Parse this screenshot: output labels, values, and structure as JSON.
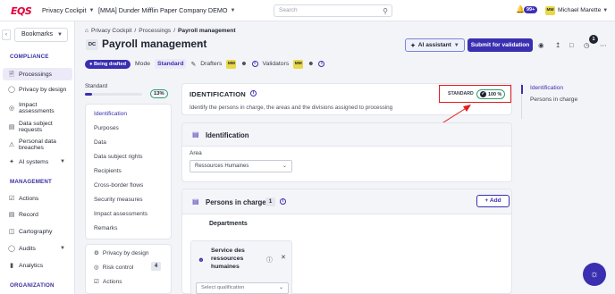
{
  "topbar": {
    "logo": "EQS",
    "product": "Privacy Cockpit",
    "company": "[MMA] Dunder Mifflin Paper Company DEMO",
    "search_placeholder": "Search",
    "notifications_badge": "99+",
    "user_initials": "MM",
    "user_name": "Michael Marette"
  },
  "sidebar": {
    "bookmarks_label": "Bookmarks",
    "sections": [
      {
        "title": "COMPLIANCE"
      },
      {
        "title": "MANAGEMENT"
      },
      {
        "title": "ORGANIZATION"
      }
    ],
    "compliance_items": [
      {
        "label": "Processings",
        "icon": "document-icon",
        "active": true
      },
      {
        "label": "Privacy by design",
        "icon": "shield-icon"
      },
      {
        "label": "Impact assessments",
        "icon": "target-icon"
      },
      {
        "label": "Data subject requests",
        "icon": "inbox-icon"
      },
      {
        "label": "Personal data breaches",
        "icon": "alert-shield-icon"
      },
      {
        "label": "AI systems",
        "icon": "sparkle-icon"
      }
    ],
    "management_items": [
      {
        "label": "Actions",
        "icon": "check-list-icon"
      },
      {
        "label": "Record",
        "icon": "book-icon"
      },
      {
        "label": "Cartography",
        "icon": "map-icon"
      },
      {
        "label": "Audits",
        "icon": "audit-icon"
      },
      {
        "label": "Analytics",
        "icon": "chart-icon"
      }
    ]
  },
  "breadcrumb": [
    "Privacy Cockpit",
    "Processings",
    "Payroll management"
  ],
  "header": {
    "badge": "DC",
    "title": "Payroll management",
    "ai_assistant": "AI assistant",
    "submit": "Submit for validation",
    "notif_count": "1"
  },
  "status": {
    "state": "Being drafted",
    "mode_label": "Mode",
    "mode_value": "Standard",
    "drafters_label": "Drafters",
    "drafters_initials": "MM",
    "validators_label": "Validators",
    "validators_initials": "MM"
  },
  "progress": {
    "label": "Standard",
    "percent": "13%",
    "fraction": 0.13
  },
  "section_nav": [
    {
      "label": "Identification",
      "active": true
    },
    {
      "label": "Purposes"
    },
    {
      "label": "Data"
    },
    {
      "label": "Data subject rights"
    },
    {
      "label": "Recipients"
    },
    {
      "label": "Cross-border flows"
    },
    {
      "label": "Security measures"
    },
    {
      "label": "Impact assessments"
    },
    {
      "label": "Remarks"
    }
  ],
  "sub_nav": [
    {
      "label": "Privacy by design"
    },
    {
      "label": "Risk control",
      "count": "4"
    },
    {
      "label": "Actions"
    }
  ],
  "identification": {
    "title": "IDENTIFICATION",
    "description": "Identify the persons in charge, the areas and the divisions assigned to processing",
    "standard_label": "STANDARD",
    "standard_percent": "100 %"
  },
  "ident_card": {
    "title": "Identification",
    "area_label": "Area",
    "area_value": "Ressources Humaines"
  },
  "persons": {
    "title": "Persons in charge",
    "count": "1",
    "add": "Add",
    "departments": "Departments",
    "service_name": "Service des ressources humaines",
    "qualification_placeholder": "Select qualification"
  },
  "outline": [
    {
      "label": "Identification",
      "active": true
    },
    {
      "label": "Persons in charge"
    }
  ],
  "colors": {
    "brand": "#3a2fb0",
    "logo_red": "#e4003a",
    "highlight_red": "#e11d1d",
    "success": "#2f9e6f"
  }
}
